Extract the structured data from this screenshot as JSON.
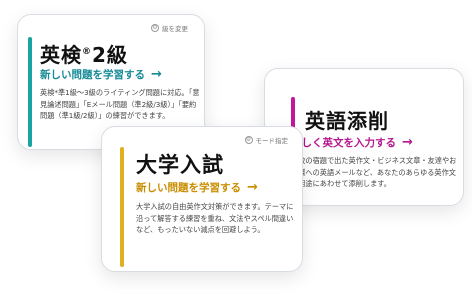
{
  "cards": {
    "eiken": {
      "title": "英検",
      "title_mark": "®",
      "title_suffix": "2級",
      "cta_label": "新しい問題を学習する",
      "cta_arrow": "→",
      "description": "英検*準1級〜3級のライティング問題に対応。「意見論述問題」「Eメール問題（準2級/3級）」「要約問題（準1級/2級）」の練習ができます。",
      "tag_label": "級を変更",
      "tag_icon": "gear-icon",
      "accent_color": "#1aa3a3"
    },
    "tensaku": {
      "title": "英語添削",
      "cta_label": "新しく英文を入力する",
      "cta_arrow": "→",
      "description": "学校の宿題で出た英作文・ビジネス文章・友達やお客様への英語メールなど、あなたのあらゆる英作文を用途にあわせて添削します。",
      "accent_color": "#c1189a"
    },
    "daigaku": {
      "title": "大学入試",
      "cta_label": "新しい問題を学習する",
      "cta_arrow": "→",
      "description": "大学入試の自由英作文対策ができます。テーマに沿って解答する練習を重ね、文法やスペル間違いなど、もったいない減点を回避しよう。",
      "tag_label": "モード指定",
      "tag_icon": "gear-icon",
      "accent_color": "#e0b020"
    }
  }
}
